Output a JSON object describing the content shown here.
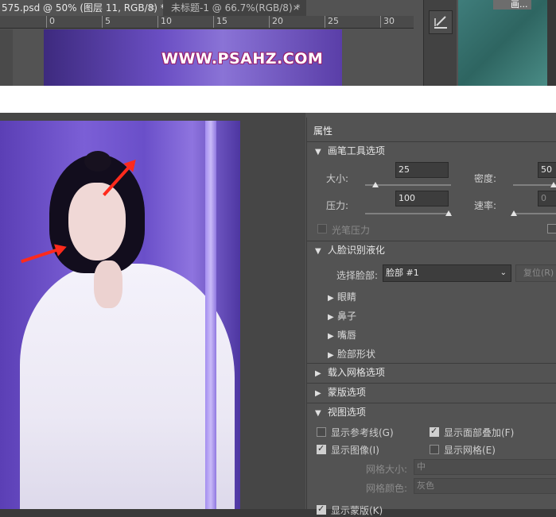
{
  "tabs": [
    {
      "label": "575.psd @ 50% (图层 11, RGB/8) *",
      "close": "×"
    },
    {
      "label": "未标题-1 @ 66.7%(RGB/8) *",
      "close": "×"
    }
  ],
  "ruler": {
    "ticks": [
      "0",
      "5",
      "10",
      "15",
      "20",
      "25",
      "30"
    ]
  },
  "preview": {
    "watermark": "WWW.PSAHZ.COM"
  },
  "side_thumb": {
    "label": "画..."
  },
  "panel": {
    "title": "属性",
    "brush": {
      "header": "画笔工具选项",
      "size_label": "大小:",
      "size_value": "25",
      "density_label": "密度:",
      "density_value": "50",
      "pressure_label": "压力:",
      "pressure_value": "100",
      "rate_label": "速率:",
      "rate_value": "0",
      "stylus_label": "光笔压力"
    },
    "face": {
      "header": "人脸识别液化",
      "select_label": "选择脸部:",
      "select_value": "脸部 #1",
      "reset_label": "复位(R)",
      "items": [
        "眼睛",
        "鼻子",
        "嘴唇",
        "脸部形状"
      ]
    },
    "load_mesh": {
      "header": "载入网格选项"
    },
    "mask": {
      "header": "蒙版选项"
    },
    "view": {
      "header": "视图选项",
      "show_guides": "显示参考线(G)",
      "show_face_overlay": "显示面部叠加(F)",
      "show_image": "显示图像(I)",
      "show_mesh": "显示网格(E)",
      "mesh_size_label": "网格大小:",
      "mesh_size_value": "中",
      "mesh_color_label": "网格颜色:",
      "mesh_color_value": "灰色"
    },
    "next_partial": "显示蒙版(K)"
  },
  "colors": {
    "accent_arrow": "#ff2a1c",
    "panel_bg": "#535353"
  }
}
